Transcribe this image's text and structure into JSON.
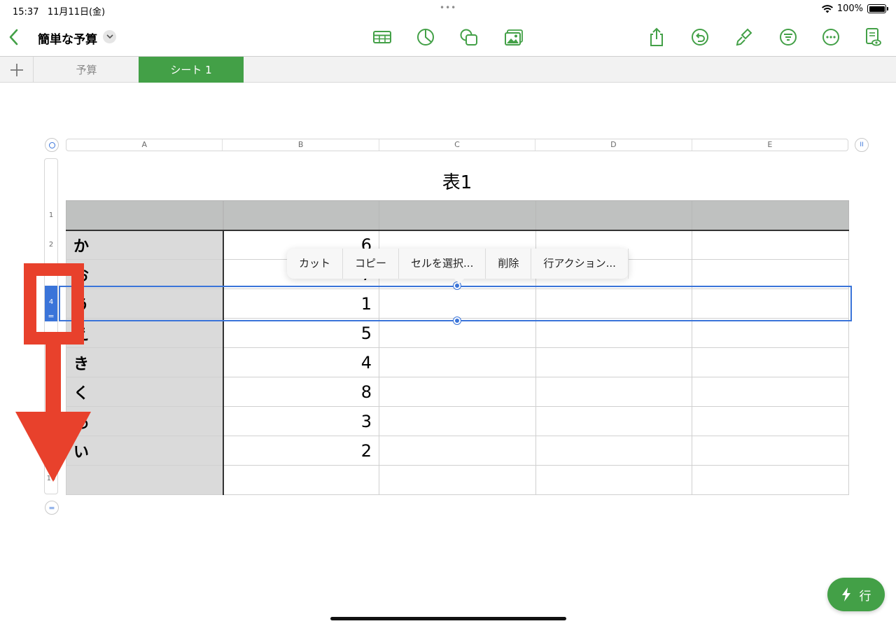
{
  "status_bar": {
    "time": "15:37",
    "date": "11月11日(金)",
    "dots": "•••",
    "battery": "100%"
  },
  "toolbar": {
    "title": "簡単な予算",
    "icons": [
      "back-icon",
      "table-icon",
      "chart-icon",
      "shape-icon",
      "media-icon",
      "share-icon",
      "undo-icon",
      "format-brush-icon",
      "organize-icon",
      "more-icon",
      "document-view-icon"
    ],
    "accent_color": "#43a047"
  },
  "tabs": [
    {
      "label": "予算",
      "active": false
    },
    {
      "label": "シート 1",
      "active": true
    }
  ],
  "columns": [
    "A",
    "B",
    "C",
    "D",
    "E"
  ],
  "row_headers": [
    "1",
    "2",
    "4",
    "10"
  ],
  "table": {
    "title": "表1",
    "rows": [
      {
        "a": "",
        "b": ""
      },
      {
        "a": "か",
        "b": "6"
      },
      {
        "a": "お",
        "b": "7"
      },
      {
        "a": "う",
        "b": "1"
      },
      {
        "a": "え",
        "b": "5"
      },
      {
        "a": "き",
        "b": "4"
      },
      {
        "a": "く",
        "b": "8"
      },
      {
        "a": "あ",
        "b": "3"
      },
      {
        "a": "い",
        "b": "2"
      },
      {
        "a": "",
        "b": ""
      }
    ]
  },
  "selected_row": {
    "label": "4",
    "grip": "="
  },
  "context_menu": [
    "カット",
    "コピー",
    "セルを選択...",
    "削除",
    "行アクション..."
  ],
  "fab": {
    "label": "行"
  },
  "bottom_grip": "=",
  "right_grip": "II"
}
